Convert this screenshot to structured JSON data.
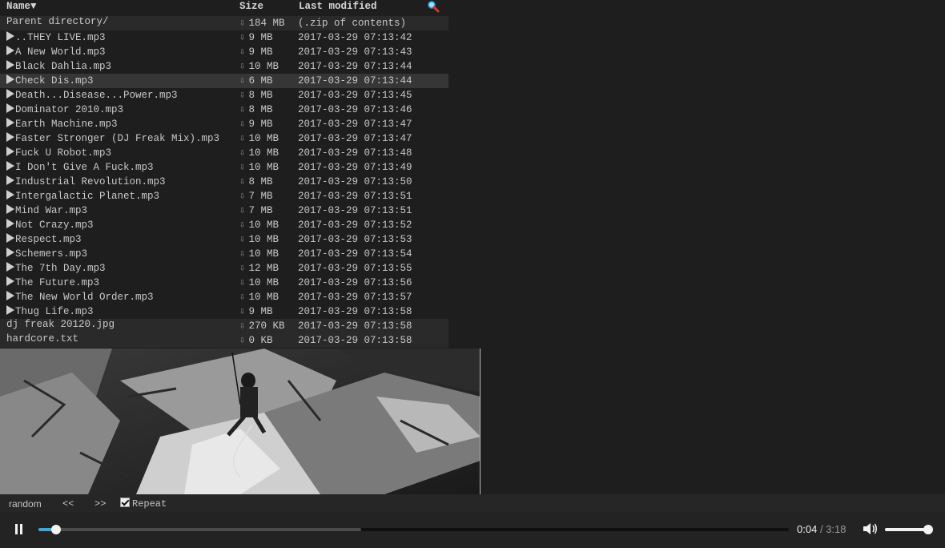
{
  "header": {
    "name_label": "Name▼",
    "size_label": "Size",
    "modified_label": "Last modified",
    "search_icon": "magnifier-icon"
  },
  "parent": {
    "name": "Parent directory/",
    "size": "184 MB",
    "modified": "(.zip of contents)"
  },
  "files": [
    {
      "name": "..THEY LIVE.mp3",
      "size": "9 MB",
      "modified": "2017-03-29 07:13:42",
      "kind": "audio"
    },
    {
      "name": "A New World.mp3",
      "size": "9 MB",
      "modified": "2017-03-29 07:13:43",
      "kind": "audio"
    },
    {
      "name": "Black Dahlia.mp3",
      "size": "10 MB",
      "modified": "2017-03-29 07:13:44",
      "kind": "audio"
    },
    {
      "name": "Check Dis.mp3",
      "size": "6 MB",
      "modified": "2017-03-29 07:13:44",
      "kind": "audio",
      "playing": true
    },
    {
      "name": "Death...Disease...Power.mp3",
      "size": "8 MB",
      "modified": "2017-03-29 07:13:45",
      "kind": "audio"
    },
    {
      "name": "Dominator 2010.mp3",
      "size": "8 MB",
      "modified": "2017-03-29 07:13:46",
      "kind": "audio"
    },
    {
      "name": "Earth Machine.mp3",
      "size": "9 MB",
      "modified": "2017-03-29 07:13:47",
      "kind": "audio"
    },
    {
      "name": "Faster Stronger (DJ Freak Mix).mp3",
      "size": "10 MB",
      "modified": "2017-03-29 07:13:47",
      "kind": "audio"
    },
    {
      "name": "Fuck U Robot.mp3",
      "size": "10 MB",
      "modified": "2017-03-29 07:13:48",
      "kind": "audio"
    },
    {
      "name": "I Don't Give A Fuck.mp3",
      "size": "10 MB",
      "modified": "2017-03-29 07:13:49",
      "kind": "audio"
    },
    {
      "name": "Industrial Revolution.mp3",
      "size": "8 MB",
      "modified": "2017-03-29 07:13:50",
      "kind": "audio"
    },
    {
      "name": "Intergalactic Planet.mp3",
      "size": "7 MB",
      "modified": "2017-03-29 07:13:51",
      "kind": "audio"
    },
    {
      "name": "Mind War.mp3",
      "size": "7 MB",
      "modified": "2017-03-29 07:13:51",
      "kind": "audio"
    },
    {
      "name": "Not Crazy.mp3",
      "size": "10 MB",
      "modified": "2017-03-29 07:13:52",
      "kind": "audio"
    },
    {
      "name": "Respect.mp3",
      "size": "10 MB",
      "modified": "2017-03-29 07:13:53",
      "kind": "audio"
    },
    {
      "name": "Schemers.mp3",
      "size": "10 MB",
      "modified": "2017-03-29 07:13:54",
      "kind": "audio"
    },
    {
      "name": "The 7th Day.mp3",
      "size": "12 MB",
      "modified": "2017-03-29 07:13:55",
      "kind": "audio"
    },
    {
      "name": "The Future.mp3",
      "size": "10 MB",
      "modified": "2017-03-29 07:13:56",
      "kind": "audio"
    },
    {
      "name": "The New World Order.mp3",
      "size": "10 MB",
      "modified": "2017-03-29 07:13:57",
      "kind": "audio"
    },
    {
      "name": "Thug Life.mp3",
      "size": "9 MB",
      "modified": "2017-03-29 07:13:58",
      "kind": "audio"
    },
    {
      "name": "dj freak 20120.jpg",
      "size": "270 KB",
      "modified": "2017-03-29 07:13:58",
      "kind": "file"
    },
    {
      "name": "hardcore.txt",
      "size": "0 KB",
      "modified": "2017-03-29 07:13:58",
      "kind": "file"
    }
  ],
  "controls": {
    "random_label": "random",
    "prev_label": "<<",
    "next_label": ">>",
    "repeat_label": "Repeat",
    "repeat_checked": true
  },
  "player": {
    "state": "playing",
    "current_time": "0:04",
    "total_time": "/ 3:18",
    "progress_fraction": 0.024,
    "buffered_fraction": 0.43,
    "volume_fraction": 1.0,
    "volume_icon": "speaker-icon",
    "pause_icon": "pause-icon"
  },
  "colors": {
    "accent": "#3ca9d9",
    "background": "#1e1e1e",
    "row_highlight": "#363636"
  }
}
